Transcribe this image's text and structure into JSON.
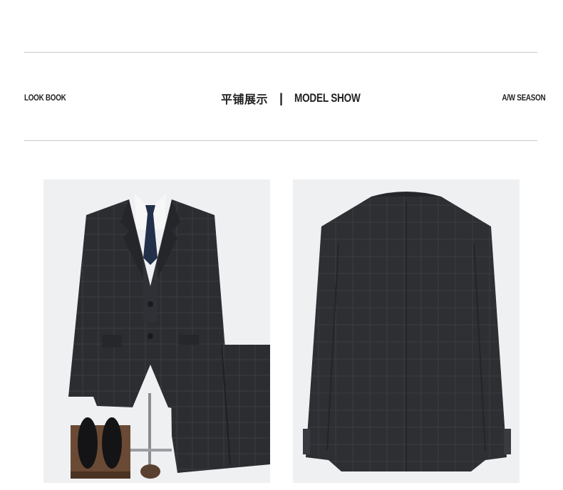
{
  "header": {
    "left_label": "LOOK BOOK",
    "title_cn": "平铺展示",
    "separator": "|",
    "title_en": "MODEL SHOW",
    "right_label": "A/W SEASON"
  },
  "colors": {
    "suit": "#2c2d31",
    "photo_bg": "#eef0f2",
    "rule": "#c9c9c9"
  }
}
